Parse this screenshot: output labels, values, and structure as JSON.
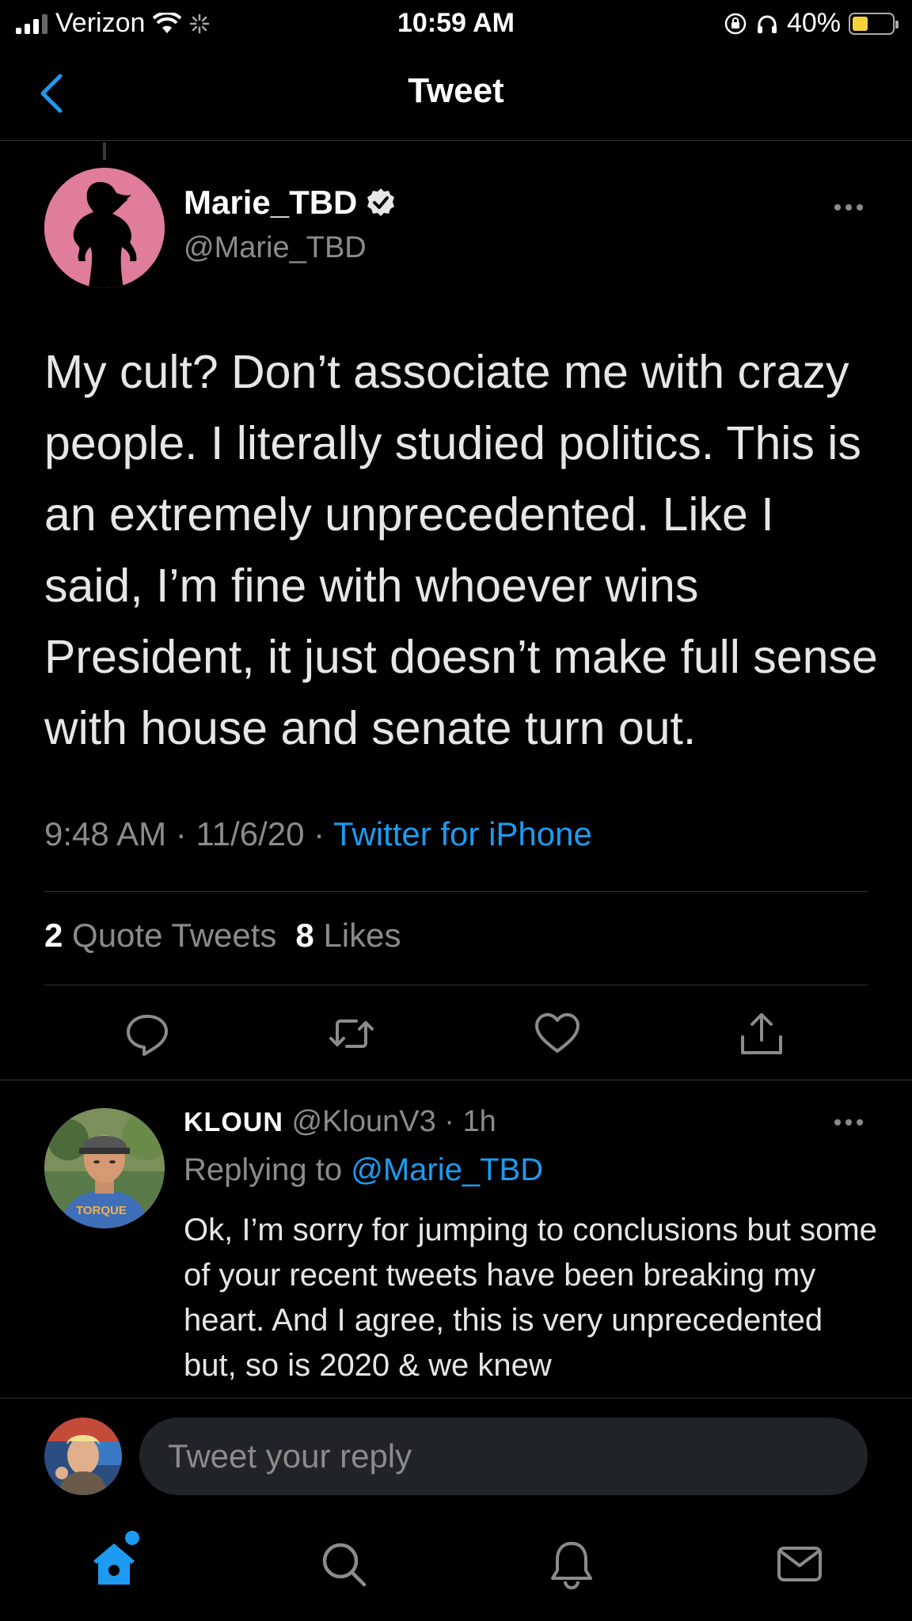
{
  "status_bar": {
    "carrier": "Verizon",
    "time": "10:59 AM",
    "battery_percent": "40%"
  },
  "header": {
    "title": "Tweet"
  },
  "tweet": {
    "display_name": "Marie_TBD",
    "handle": "@Marie_TBD",
    "text": "My cult? Don’t associate me with crazy people. I literally studied politics. This is an extremely unprecedented. Like I said, I’m fine with whoever wins President, it just doesn’t make full sense with house and senate turn out.",
    "time": "9:48 AM",
    "date": "11/6/20",
    "source": "Twitter for iPhone",
    "quote_count": "2",
    "quote_label": "Quote Tweets",
    "like_count": "8",
    "like_label": "Likes"
  },
  "reply": {
    "display_name": "KLOUN",
    "handle": "@KlounV3",
    "age": "1h",
    "replying_prefix": "Replying to",
    "replying_to": "@Marie_TBD",
    "text": "Ok, I’m sorry for jumping to conclusions but some of your recent tweets have been breaking my heart. And I agree, this is very unprecedented but, so is 2020 & we knew",
    "avatar_shirt_text": "TORQUE"
  },
  "compose": {
    "placeholder": "Tweet your reply"
  },
  "colors": {
    "background": "#000000",
    "accent": "#1d9bf0",
    "muted_text": "#8b8b8b",
    "divider": "#2f3336"
  },
  "icons": {
    "header": [
      "back-chevron-icon"
    ],
    "actions": [
      "reply-icon",
      "retweet-icon",
      "like-icon",
      "share-icon"
    ],
    "tabs": [
      "home-icon",
      "search-icon",
      "notifications-icon",
      "messages-icon"
    ]
  }
}
